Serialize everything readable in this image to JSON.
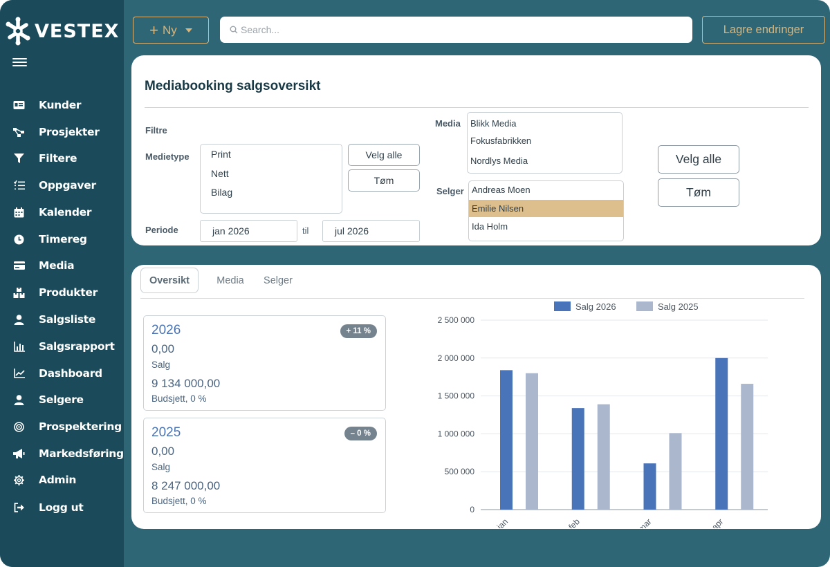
{
  "brand": {
    "name": "VESTEX"
  },
  "sidebar": {
    "items": [
      {
        "label": "Kunder",
        "icon": "id-card-icon"
      },
      {
        "label": "Prosjekter",
        "icon": "hierarchy-icon"
      },
      {
        "label": "Filtere",
        "icon": "filter-icon"
      },
      {
        "label": "Oppgaver",
        "icon": "task-list-icon"
      },
      {
        "label": "Kalender",
        "icon": "calendar-icon"
      },
      {
        "label": "Timereg",
        "icon": "clock-icon"
      },
      {
        "label": "Media",
        "icon": "credit-card-icon"
      },
      {
        "label": "Produkter",
        "icon": "boxes-icon"
      },
      {
        "label": "Salgsliste",
        "icon": "user-icon"
      },
      {
        "label": "Salgsrapport",
        "icon": "bar-chart-icon"
      },
      {
        "label": "Dashboard",
        "icon": "line-chart-icon"
      },
      {
        "label": "Selgere",
        "icon": "user-icon"
      },
      {
        "label": "Prospektering",
        "icon": "target-icon"
      },
      {
        "label": "Markedsføring",
        "icon": "megaphone-icon"
      },
      {
        "label": "Admin",
        "icon": "gear-icon"
      },
      {
        "label": "Logg ut",
        "icon": "logout-icon"
      }
    ]
  },
  "topbar": {
    "new_label": "Ny",
    "search_placeholder": "Search...",
    "save_label": "Lagre endringer"
  },
  "filters": {
    "title": "Mediabooking salgsoversikt",
    "section_label": "Filtre",
    "medietype_label": "Medietype",
    "medietype_options": [
      "Print",
      "Nett",
      "Bilag"
    ],
    "select_all": "Velg alle",
    "clear": "Tøm",
    "periode_label": "Periode",
    "periode_from": "jan 2026",
    "periode_sep": "til",
    "periode_to": "jul 2026",
    "media_label": "Media",
    "media_options": [
      "Blikk Media",
      "Fokusfabrikken",
      "Nordlys Media"
    ],
    "selger_label": "Selger",
    "selger_options": [
      "Andreas Moen",
      "Emilie Nilsen",
      "Ida Holm"
    ],
    "selger_selected": "Emilie Nilsen",
    "select_all_2": "Velg alle",
    "clear_2": "Tøm"
  },
  "tabs": [
    "Oversikt",
    "Media",
    "Selger"
  ],
  "active_tab": "Oversikt",
  "kpis": [
    {
      "year": "2026",
      "badge": "+ 11 %",
      "value": "0,00",
      "value_label": "Salg",
      "budget": "9 134 000,00",
      "budget_label": "Budsjett, 0 %"
    },
    {
      "year": "2025",
      "badge": "– 0 %",
      "value": "0,00",
      "value_label": "Salg",
      "budget": "8 247 000,00",
      "budget_label": "Budsjett, 0 %"
    }
  ],
  "colors": {
    "sidebar": "#1b4b5a",
    "background": "#2f6675",
    "accent": "#d8b57a",
    "series_2026": "#4a74b9",
    "series_2025": "#aab7cd"
  },
  "chart_data": {
    "type": "bar",
    "categories": [
      "jan",
      "feb",
      "mar",
      "apr"
    ],
    "series": [
      {
        "name": "Salg 2026",
        "values": [
          1840000,
          1340000,
          610000,
          2000000
        ],
        "color": "#4a74b9"
      },
      {
        "name": "Salg 2025",
        "values": [
          1800000,
          1390000,
          1010000,
          1660000
        ],
        "color": "#aab7cd"
      }
    ],
    "ylim": [
      0,
      2500000
    ],
    "yticks": [
      "0",
      "500 000",
      "1 000 000",
      "1 500 000",
      "2 000 000",
      "2 500 000"
    ],
    "ytick_values": [
      0,
      500000,
      1000000,
      1500000,
      2000000,
      2500000
    ],
    "legend": "top",
    "grid": true
  }
}
